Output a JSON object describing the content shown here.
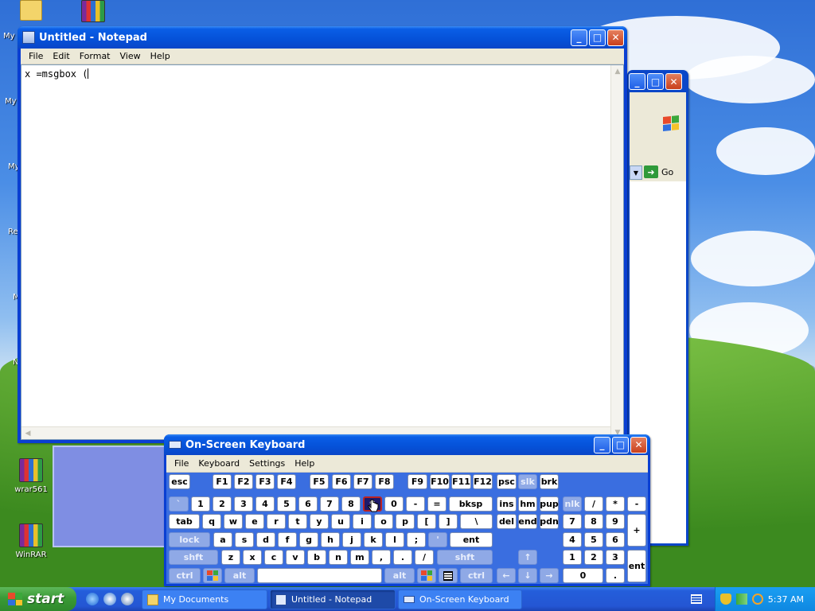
{
  "desktop": {
    "icons": [
      {
        "label": "wrar561"
      },
      {
        "label": "WinRAR"
      }
    ],
    "cut_labels": [
      "My I",
      "My",
      "My",
      "Re",
      "M",
      "N"
    ]
  },
  "notepad": {
    "title": "Untitled - Notepad",
    "menu": [
      "File",
      "Edit",
      "Format",
      "View",
      "Help"
    ],
    "content": "x =msgbox ("
  },
  "ie": {
    "go_label": "Go"
  },
  "osk": {
    "title": "On-Screen Keyboard",
    "menu": [
      "File",
      "Keyboard",
      "Settings",
      "Help"
    ],
    "keys": {
      "esc": "esc",
      "f": [
        "F1",
        "F2",
        "F3",
        "F4",
        "F5",
        "F6",
        "F7",
        "F8",
        "F9",
        "F10",
        "F11",
        "F12"
      ],
      "psc": "psc",
      "slk": "slk",
      "brk": "brk",
      "row1": [
        "`",
        "1",
        "2",
        "3",
        "4",
        "5",
        "6",
        "7",
        "8",
        "9",
        "0",
        "-",
        "="
      ],
      "bksp": "bksp",
      "ins": "ins",
      "hm": "hm",
      "pup": "pup",
      "nlk": "nlk",
      "numdiv": "/",
      "nummul": "*",
      "numsub": "-",
      "tab": "tab",
      "row2": [
        "q",
        "w",
        "e",
        "r",
        "t",
        "y",
        "u",
        "i",
        "o",
        "p",
        "[",
        "]",
        "\\"
      ],
      "del": "del",
      "end": "end",
      "pdn": "pdn",
      "num789": [
        "7",
        "8",
        "9"
      ],
      "numadd": "+",
      "lock": "lock",
      "row3": [
        "a",
        "s",
        "d",
        "f",
        "g",
        "h",
        "j",
        "k",
        "l",
        ";",
        "'"
      ],
      "ent": "ent",
      "num456": [
        "4",
        "5",
        "6"
      ],
      "shft": "shft",
      "row4": [
        "z",
        "x",
        "c",
        "v",
        "b",
        "n",
        "m",
        ",",
        ".",
        "/"
      ],
      "up": "↑",
      "num123": [
        "1",
        "2",
        "3"
      ],
      "nument": "ent",
      "ctrl": "ctrl",
      "alt": "alt",
      "left": "←",
      "down": "↓",
      "right": "→",
      "num0": "0",
      "numdot": "."
    }
  },
  "taskbar": {
    "start": "start",
    "tasks": [
      "My Documents",
      "Untitled - Notepad",
      "On-Screen Keyboard"
    ],
    "clock": "5:37 AM"
  }
}
